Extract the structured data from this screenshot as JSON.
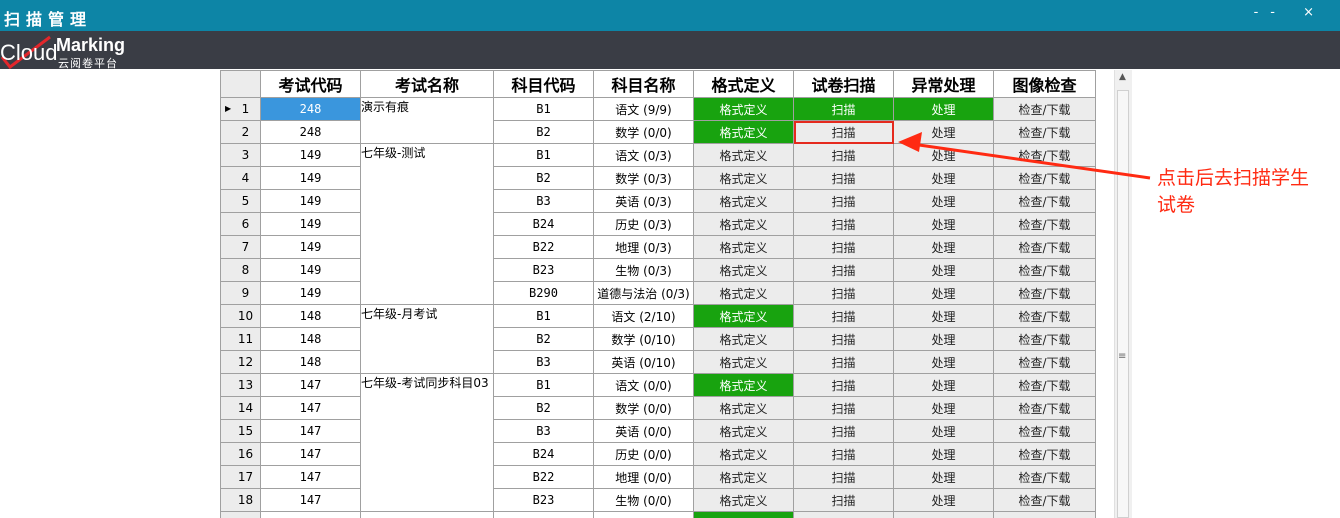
{
  "window": {
    "title": "扫描管理",
    "controls": "-- ×"
  },
  "brand": {
    "word1": "Cloud",
    "word2": "Marking",
    "subtitle": "云阅卷平台"
  },
  "table": {
    "headers": [
      "考试代码",
      "考试名称",
      "科目代码",
      "科目名称",
      "格式定义",
      "试卷扫描",
      "异常处理",
      "图像检查"
    ],
    "rows": [
      {
        "n": "1",
        "code": "248",
        "subcode": "B1",
        "subname": "语文 (9/9)",
        "format": "格式定义",
        "scan": "扫描",
        "exc": "处理",
        "img": "检查/下载"
      },
      {
        "n": "2",
        "code": "248",
        "subcode": "B2",
        "subname": "数学 (0/0)",
        "format": "格式定义",
        "scan": "扫描",
        "exc": "处理",
        "img": "检查/下载"
      },
      {
        "n": "3",
        "code": "149",
        "subcode": "B1",
        "subname": "语文 (0/3)",
        "format": "格式定义",
        "scan": "扫描",
        "exc": "处理",
        "img": "检查/下载"
      },
      {
        "n": "4",
        "code": "149",
        "subcode": "B2",
        "subname": "数学 (0/3)",
        "format": "格式定义",
        "scan": "扫描",
        "exc": "处理",
        "img": "检查/下载"
      },
      {
        "n": "5",
        "code": "149",
        "subcode": "B3",
        "subname": "英语 (0/3)",
        "format": "格式定义",
        "scan": "扫描",
        "exc": "处理",
        "img": "检查/下载"
      },
      {
        "n": "6",
        "code": "149",
        "subcode": "B24",
        "subname": "历史 (0/3)",
        "format": "格式定义",
        "scan": "扫描",
        "exc": "处理",
        "img": "检查/下载"
      },
      {
        "n": "7",
        "code": "149",
        "subcode": "B22",
        "subname": "地理 (0/3)",
        "format": "格式定义",
        "scan": "扫描",
        "exc": "处理",
        "img": "检查/下载"
      },
      {
        "n": "8",
        "code": "149",
        "subcode": "B23",
        "subname": "生物 (0/3)",
        "format": "格式定义",
        "scan": "扫描",
        "exc": "处理",
        "img": "检查/下载"
      },
      {
        "n": "9",
        "code": "149",
        "subcode": "B290",
        "subname": "道德与法治 (0/3)",
        "format": "格式定义",
        "scan": "扫描",
        "exc": "处理",
        "img": "检查/下载"
      },
      {
        "n": "10",
        "code": "148",
        "subcode": "B1",
        "subname": "语文 (2/10)",
        "format": "格式定义",
        "scan": "扫描",
        "exc": "处理",
        "img": "检查/下载"
      },
      {
        "n": "11",
        "code": "148",
        "subcode": "B2",
        "subname": "数学 (0/10)",
        "format": "格式定义",
        "scan": "扫描",
        "exc": "处理",
        "img": "检查/下载"
      },
      {
        "n": "12",
        "code": "148",
        "subcode": "B3",
        "subname": "英语 (0/10)",
        "format": "格式定义",
        "scan": "扫描",
        "exc": "处理",
        "img": "检查/下载"
      },
      {
        "n": "13",
        "code": "147",
        "subcode": "B1",
        "subname": "语文 (0/0)",
        "format": "格式定义",
        "scan": "扫描",
        "exc": "处理",
        "img": "检查/下载"
      },
      {
        "n": "14",
        "code": "147",
        "subcode": "B2",
        "subname": "数学 (0/0)",
        "format": "格式定义",
        "scan": "扫描",
        "exc": "处理",
        "img": "检查/下载"
      },
      {
        "n": "15",
        "code": "147",
        "subcode": "B3",
        "subname": "英语 (0/0)",
        "format": "格式定义",
        "scan": "扫描",
        "exc": "处理",
        "img": "检查/下载"
      },
      {
        "n": "16",
        "code": "147",
        "subcode": "B24",
        "subname": "历史 (0/0)",
        "format": "格式定义",
        "scan": "扫描",
        "exc": "处理",
        "img": "检查/下载"
      },
      {
        "n": "17",
        "code": "147",
        "subcode": "B22",
        "subname": "地理 (0/0)",
        "format": "格式定义",
        "scan": "扫描",
        "exc": "处理",
        "img": "检查/下载"
      },
      {
        "n": "18",
        "code": "147",
        "subcode": "B23",
        "subname": "生物 (0/0)",
        "format": "格式定义",
        "scan": "扫描",
        "exc": "处理",
        "img": "检查/下载"
      }
    ],
    "exam_names": [
      "演示有痕",
      "七年级-测试",
      "七年级-月考试",
      "七年级-考试同步科目03"
    ]
  },
  "annotation": {
    "line1": "点击后去扫描学生",
    "line2": "试卷"
  },
  "colors": {
    "titlebar": "#0d85a6",
    "brandbar": "#3a3d45",
    "green": "#18a30f",
    "selected": "#3a96dd",
    "annotation": "#ff2a12"
  }
}
